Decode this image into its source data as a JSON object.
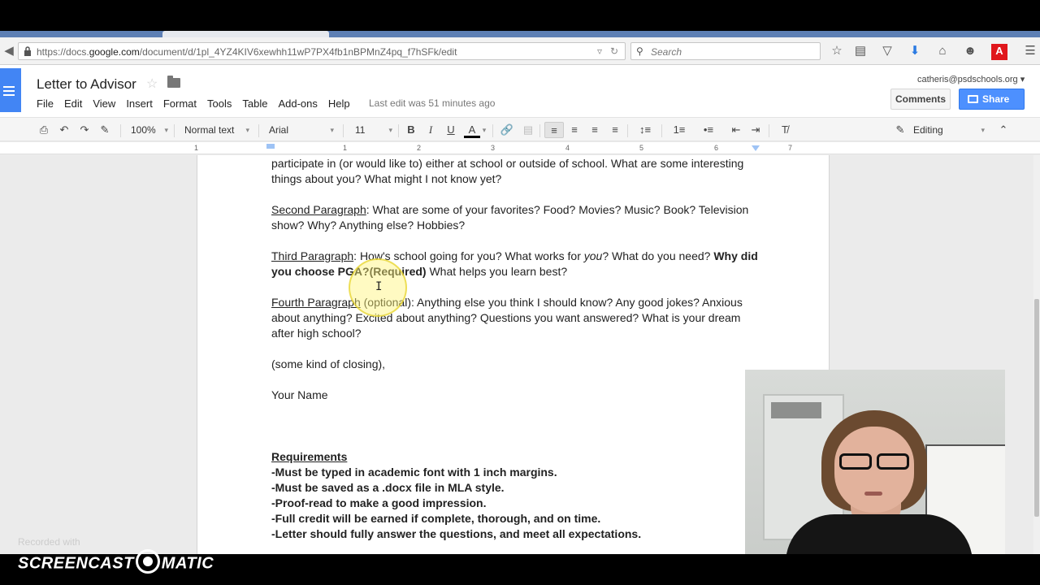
{
  "browser": {
    "url_prefix": "https://docs.",
    "url_domain": "google.com",
    "url_path": "/document/d/1pl_4YZ4KIV6xewhh11wP7PX4fb1nBPMnZ4pq_f7hSFk/edit",
    "search_placeholder": "Search"
  },
  "docs": {
    "title": "Letter to Advisor",
    "account": "catheris@psdschools.org",
    "menu": [
      "File",
      "Edit",
      "View",
      "Insert",
      "Format",
      "Tools",
      "Table",
      "Add-ons",
      "Help"
    ],
    "last_edit": "Last edit was 51 minutes ago",
    "comments_label": "Comments",
    "share_label": "Share"
  },
  "toolbar": {
    "zoom": "100%",
    "style": "Normal text",
    "font": "Arial",
    "size": "11",
    "bold": "B",
    "italic": "I",
    "underline": "U",
    "text_color": "A",
    "mode": "Editing"
  },
  "ruler": {
    "numbers": [
      "1",
      "1",
      "2",
      "3",
      "4",
      "5",
      "6",
      "7"
    ]
  },
  "document": {
    "para1_text": "participate in (or would like to) either at school or outside of school. What are some interesting things about you? What might I not know yet?",
    "para2_label": "Second Paragraph",
    "para2_text": ": What are some of your favorites? Food? Movies? Music? Book? Television show? Why? Anything else? Hobbies?",
    "para3_label": "Third Paragraph",
    "para3_text_a": ": How's school going for you? What works for ",
    "para3_italic": "you",
    "para3_text_b": "? What do you need? ",
    "para3_bold": "Why did you choose PGA?(Required)",
    "para3_text_c": " What helps you learn best?",
    "para4_label": "Fourth Paragraph",
    "para4_text": " (optional): Anything else you think I should know? Any good jokes? Anxious about anything? Excited about anything? Questions you want answered? What is your dream after high school?",
    "closing": "(some kind of closing),",
    "name": "Your Name",
    "requirements_title": "Requirements",
    "requirements": [
      "-Must be typed in academic font with 1 inch margins.",
      "-Must be saved as a .docx file in MLA style.",
      "-Proof-read to make a good impression.",
      "-Full credit will be earned if complete, thorough, and on time.",
      "-Letter should fully answer the questions, and meet all expectations."
    ]
  },
  "watermark": {
    "recorded_with": "Recorded with",
    "brand_left": "SCREENCAST",
    "brand_right": "MATIC"
  },
  "colors": {
    "docs_blue": "#4285f4",
    "share_blue": "#4d90fe",
    "adobe_red": "#e0171c"
  }
}
